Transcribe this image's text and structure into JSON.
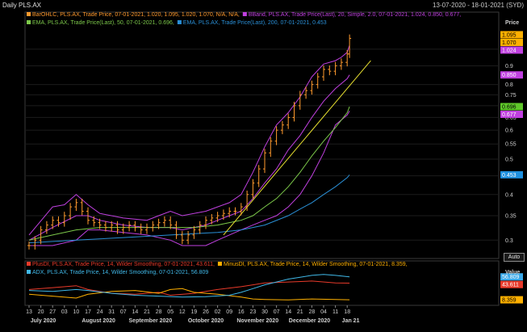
{
  "window": {
    "title": "Daily PLS.AX",
    "date_range": "13-07-2020 - 18-01-2021 (SYD)"
  },
  "controls": {
    "auto_label": "Auto"
  },
  "chart_data": [
    {
      "type": "line",
      "panel": "price",
      "yaxis_title": "Price",
      "scale": "log",
      "ylim": [
        0.27,
        1.2
      ],
      "yticks": [
        "1",
        "0.9",
        "0.8",
        "0.75",
        "0.7",
        "0.65",
        "0.6",
        "0.55",
        "0.5",
        "0.45",
        "0.4",
        "0.35",
        "0.3"
      ],
      "legend": [
        {
          "text": "BarOHLC, PLS.AX, Trade Price, 07-01-2021, 1.020, 1.095, 1.020, 1.070, N/A, N/A,",
          "color": "#ff9a2e"
        },
        {
          "text": "BBand, PLS.AX, Trade Price(Last), 20, Simple, 2.0, 07-01-2021, 1.024, 0.850, 0.677,",
          "color": "#c040e0"
        },
        {
          "text": "EMA, PLS.AX, Trade Price(Last), 50, 07-01-2021, 0.696,",
          "color": "#7cc84a"
        },
        {
          "text": "EMA, PLS.AX, Trade Price(Last), 200, 07-01-2021, 0.453",
          "color": "#2a8fd6"
        }
      ],
      "value_tags": [
        {
          "text": "1.070",
          "value": 1.07,
          "bg": "#ffb000",
          "fg": "#000000"
        },
        {
          "text": "1.095",
          "value": 1.095,
          "bg": "#ffb000",
          "fg": "#000000"
        },
        {
          "text": "1.024",
          "value": 1.024,
          "bg": "#c040e0",
          "fg": "#ffffff"
        },
        {
          "text": "0.850",
          "value": 0.85,
          "bg": "#c040e0",
          "fg": "#ffffff"
        },
        {
          "text": "0.696",
          "value": 0.696,
          "bg": "#5fc82a",
          "fg": "#000000"
        },
        {
          "text": "0.677",
          "value": 0.677,
          "bg": "#c040e0",
          "fg": "#ffffff"
        },
        {
          "text": "0.453",
          "value": 0.453,
          "bg": "#1e90e0",
          "fg": "#ffffff"
        }
      ],
      "x_categories": [
        "13",
        "20",
        "27",
        "03",
        "10",
        "17",
        "24",
        "31",
        "07",
        "14",
        "21",
        "28",
        "05",
        "12",
        "19",
        "26",
        "02",
        "09",
        "16",
        "23",
        "30",
        "07",
        "14",
        "21",
        "28",
        "04",
        "11",
        "18"
      ],
      "months": [
        "July 2020",
        "August 2020",
        "September 2020",
        "October 2020",
        "November 2020",
        "December 2020",
        "Jan 21"
      ],
      "series": [
        {
          "name": "BarOHLC close",
          "color": "#ff9a2e",
          "points": [
            [
              0,
              0.29
            ],
            [
              0.5,
              0.3
            ],
            [
              1,
              0.32
            ],
            [
              1.5,
              0.33
            ],
            [
              2,
              0.34
            ],
            [
              2.5,
              0.335
            ],
            [
              3,
              0.35
            ],
            [
              3.5,
              0.37
            ],
            [
              4,
              0.38
            ],
            [
              4.5,
              0.36
            ],
            [
              5,
              0.34
            ],
            [
              5.5,
              0.335
            ],
            [
              6,
              0.33
            ],
            [
              6.5,
              0.325
            ],
            [
              7,
              0.33
            ],
            [
              7.5,
              0.32
            ],
            [
              8,
              0.325
            ],
            [
              8.5,
              0.33
            ],
            [
              9,
              0.325
            ],
            [
              9.5,
              0.32
            ],
            [
              10,
              0.325
            ],
            [
              10.5,
              0.33
            ],
            [
              11,
              0.335
            ],
            [
              11.5,
              0.34
            ],
            [
              12,
              0.33
            ],
            [
              12.5,
              0.31
            ],
            [
              13,
              0.3
            ],
            [
              13.5,
              0.31
            ],
            [
              14,
              0.32
            ],
            [
              14.5,
              0.33
            ],
            [
              15,
              0.34
            ],
            [
              15.5,
              0.345
            ],
            [
              16,
              0.35
            ],
            [
              16.5,
              0.355
            ],
            [
              17,
              0.36
            ],
            [
              17.5,
              0.36
            ],
            [
              18,
              0.37
            ],
            [
              18.5,
              0.4
            ],
            [
              19,
              0.43
            ],
            [
              19.5,
              0.47
            ],
            [
              20,
              0.52
            ],
            [
              20.5,
              0.56
            ],
            [
              21,
              0.6
            ],
            [
              21.5,
              0.62
            ],
            [
              22,
              0.65
            ],
            [
              22.5,
              0.7
            ],
            [
              23,
              0.75
            ],
            [
              23.5,
              0.77
            ],
            [
              24,
              0.8
            ],
            [
              24.5,
              0.84
            ],
            [
              25,
              0.88
            ],
            [
              25.5,
              0.87
            ],
            [
              26,
              0.9
            ],
            [
              26.5,
              0.92
            ],
            [
              27,
              0.97
            ],
            [
              27.2,
              1.07
            ]
          ]
        },
        {
          "name": "BBand upper",
          "color": "#c040e0",
          "points": [
            [
              0,
              0.31
            ],
            [
              2,
              0.37
            ],
            [
              3,
              0.375
            ],
            [
              4,
              0.4
            ],
            [
              5,
              0.375
            ],
            [
              6,
              0.355
            ],
            [
              8,
              0.345
            ],
            [
              10,
              0.34
            ],
            [
              11,
              0.35
            ],
            [
              12,
              0.36
            ],
            [
              13,
              0.35
            ],
            [
              15,
              0.36
            ],
            [
              16,
              0.37
            ],
            [
              17,
              0.38
            ],
            [
              18,
              0.4
            ],
            [
              19,
              0.46
            ],
            [
              20,
              0.54
            ],
            [
              21,
              0.62
            ],
            [
              22,
              0.67
            ],
            [
              23,
              0.74
            ],
            [
              24,
              0.84
            ],
            [
              25,
              0.91
            ],
            [
              26,
              0.93
            ],
            [
              26.5,
              0.95
            ],
            [
              27,
              0.98
            ],
            [
              27.2,
              1.024
            ]
          ]
        },
        {
          "name": "BBand middle",
          "color": "#c040e0",
          "points": [
            [
              0,
              0.3
            ],
            [
              2,
              0.325
            ],
            [
              4,
              0.35
            ],
            [
              5,
              0.35
            ],
            [
              6,
              0.34
            ],
            [
              8,
              0.33
            ],
            [
              10,
              0.325
            ],
            [
              12,
              0.325
            ],
            [
              13,
              0.32
            ],
            [
              15,
              0.33
            ],
            [
              16,
              0.34
            ],
            [
              17,
              0.35
            ],
            [
              18,
              0.36
            ],
            [
              19,
              0.39
            ],
            [
              20,
              0.43
            ],
            [
              21,
              0.47
            ],
            [
              22,
              0.53
            ],
            [
              23,
              0.58
            ],
            [
              24,
              0.65
            ],
            [
              25,
              0.72
            ],
            [
              26,
              0.78
            ],
            [
              27,
              0.83
            ],
            [
              27.2,
              0.85
            ]
          ]
        },
        {
          "name": "BBand lower",
          "color": "#c040e0",
          "points": [
            [
              0,
              0.29
            ],
            [
              2,
              0.29
            ],
            [
              4,
              0.3
            ],
            [
              5,
              0.32
            ],
            [
              6,
              0.32
            ],
            [
              8,
              0.315
            ],
            [
              10,
              0.31
            ],
            [
              12,
              0.3
            ],
            [
              13,
              0.29
            ],
            [
              15,
              0.29
            ],
            [
              16,
              0.3
            ],
            [
              17,
              0.31
            ],
            [
              18,
              0.32
            ],
            [
              19,
              0.33
            ],
            [
              20,
              0.34
            ],
            [
              21,
              0.35
            ],
            [
              22,
              0.37
            ],
            [
              23,
              0.4
            ],
            [
              24,
              0.45
            ],
            [
              25,
              0.52
            ],
            [
              26,
              0.62
            ],
            [
              27,
              0.66
            ],
            [
              27.2,
              0.677
            ]
          ]
        },
        {
          "name": "EMA 50",
          "color": "#7cc84a",
          "points": [
            [
              0,
              0.3
            ],
            [
              2,
              0.31
            ],
            [
              4,
              0.32
            ],
            [
              6,
              0.325
            ],
            [
              8,
              0.325
            ],
            [
              10,
              0.325
            ],
            [
              12,
              0.325
            ],
            [
              14,
              0.325
            ],
            [
              16,
              0.33
            ],
            [
              17,
              0.335
            ],
            [
              18,
              0.34
            ],
            [
              19,
              0.35
            ],
            [
              20,
              0.37
            ],
            [
              21,
              0.39
            ],
            [
              22,
              0.42
            ],
            [
              23,
              0.46
            ],
            [
              24,
              0.51
            ],
            [
              25,
              0.56
            ],
            [
              26,
              0.61
            ],
            [
              27,
              0.67
            ],
            [
              27.2,
              0.696
            ]
          ]
        },
        {
          "name": "EMA 200",
          "color": "#2a8fd6",
          "points": [
            [
              0,
              0.295
            ],
            [
              4,
              0.3
            ],
            [
              8,
              0.305
            ],
            [
              12,
              0.31
            ],
            [
              16,
              0.315
            ],
            [
              18,
              0.32
            ],
            [
              20,
              0.33
            ],
            [
              22,
              0.35
            ],
            [
              23,
              0.365
            ],
            [
              24,
              0.38
            ],
            [
              25,
              0.4
            ],
            [
              26,
              0.42
            ],
            [
              27,
              0.445
            ],
            [
              27.2,
              0.453
            ]
          ]
        },
        {
          "name": "Trendline",
          "color": "#e8e030",
          "points": [
            [
              16.5,
              0.31
            ],
            [
              29,
              0.93
            ]
          ]
        }
      ]
    },
    {
      "type": "line",
      "panel": "indicator",
      "yaxis_title": "Value",
      "ylim": [
        0,
        70
      ],
      "legend": [
        {
          "text": "PlusDI, PLS.AX, Trade Price, 14, Wilder Smoothing, 07-01-2021, 43.611,",
          "color": "#e83a2a"
        },
        {
          "text": "MinusDI, PLS.AX, Trade Price, 14, Wilder Smoothing, 07-01-2021, 8.359,",
          "color": "#ffb000"
        },
        {
          "text": "ADX, PLS.AX, Trade Price, 14, Wilder Smoothing, 07-01-2021, 56.809",
          "color": "#40b8e8"
        }
      ],
      "value_tags": [
        {
          "text": "56.809",
          "value": 56.809,
          "bg": "#3aa8e8",
          "fg": "#ffffff"
        },
        {
          "text": "43.611",
          "value": 43.611,
          "bg": "#e83a2a",
          "fg": "#ffffff"
        },
        {
          "text": "8.359",
          "value": 8.359,
          "bg": "#ffb000",
          "fg": "#000000"
        }
      ],
      "series": [
        {
          "name": "PlusDI",
          "color": "#e83a2a",
          "points": [
            [
              0,
              30
            ],
            [
              2,
              34
            ],
            [
              4,
              38
            ],
            [
              5,
              30
            ],
            [
              7,
              22
            ],
            [
              9,
              20
            ],
            [
              11,
              24
            ],
            [
              12,
              18
            ],
            [
              14,
              22
            ],
            [
              16,
              30
            ],
            [
              18,
              36
            ],
            [
              19,
              40
            ],
            [
              20,
              44
            ],
            [
              22,
              46
            ],
            [
              24,
              48
            ],
            [
              26,
              44
            ],
            [
              27.2,
              43.6
            ]
          ]
        },
        {
          "name": "MinusDI",
          "color": "#ffb000",
          "points": [
            [
              0,
              20
            ],
            [
              2,
              16
            ],
            [
              4,
              12
            ],
            [
              5,
              20
            ],
            [
              7,
              26
            ],
            [
              9,
              28
            ],
            [
              11,
              22
            ],
            [
              12,
              30
            ],
            [
              13,
              32
            ],
            [
              14,
              24
            ],
            [
              16,
              20
            ],
            [
              18,
              14
            ],
            [
              19,
              10
            ],
            [
              20,
              9
            ],
            [
              22,
              8
            ],
            [
              24,
              10
            ],
            [
              26,
              9
            ],
            [
              27.2,
              8.4
            ]
          ]
        },
        {
          "name": "ADX",
          "color": "#40b8e8",
          "points": [
            [
              0,
              28
            ],
            [
              2,
              26
            ],
            [
              4,
              30
            ],
            [
              5,
              28
            ],
            [
              7,
              22
            ],
            [
              9,
              18
            ],
            [
              11,
              16
            ],
            [
              13,
              14
            ],
            [
              15,
              15
            ],
            [
              17,
              18
            ],
            [
              18,
              24
            ],
            [
              19,
              32
            ],
            [
              20,
              40
            ],
            [
              21,
              46
            ],
            [
              22,
              52
            ],
            [
              23,
              56
            ],
            [
              24,
              60
            ],
            [
              25,
              62
            ],
            [
              26,
              60
            ],
            [
              27.2,
              56.8
            ]
          ]
        }
      ]
    }
  ]
}
